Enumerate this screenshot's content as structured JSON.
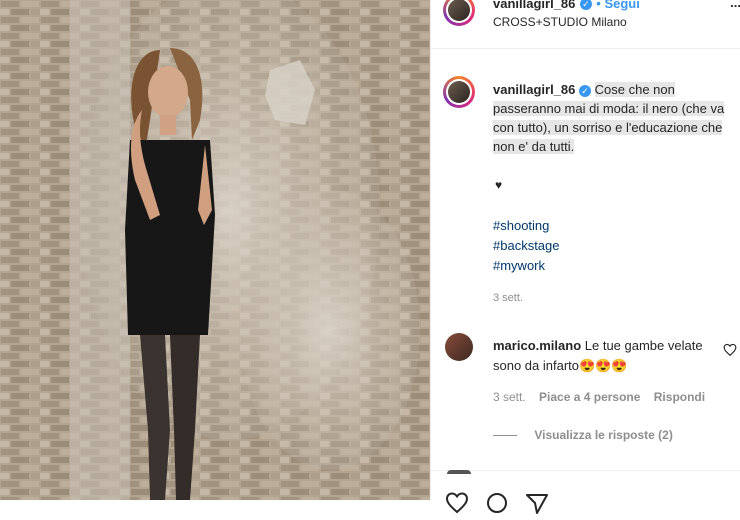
{
  "post": {
    "username": "vanillagirl_86",
    "follow_label": "• Segui",
    "location": "CROSS+STUDIO Milano",
    "more_label": "...",
    "caption": "Cose che non passeranno mai di moda: il nero (che va con tutto), un sorriso e l'educazione che non e' da tutti.",
    "heart_line": "♥",
    "hashtags": [
      "#shooting",
      "#backstage",
      "#mywork"
    ],
    "time": "3 sett."
  },
  "comment": {
    "username": "marico.milano",
    "text": "Le tue gambe velate sono da infarto",
    "emojis": "😍😍😍",
    "time": "3 sett.",
    "likes": "Piace a 4 persone",
    "reply": "Rispondi",
    "view_replies": "Visualizza le risposte (2)"
  },
  "colors": {
    "accent": "#3897f0",
    "link": "#00376b",
    "muted": "#8e8e8e"
  },
  "icons": [
    "verified-icon",
    "heart-icon",
    "comment-icon",
    "share-icon"
  ]
}
